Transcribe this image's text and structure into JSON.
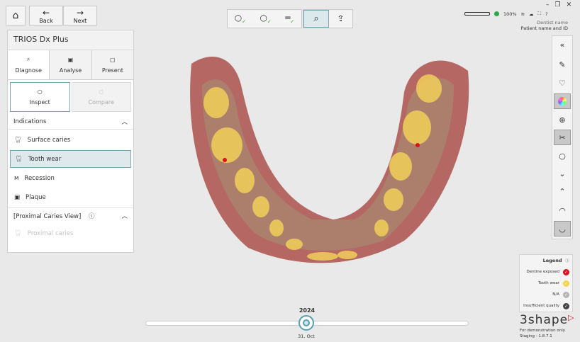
{
  "nav": {
    "back": "Back",
    "next": "Next"
  },
  "status": {
    "battery": "100%",
    "dentist": "Dentist name",
    "patient": "Patient name and ID"
  },
  "panel": {
    "title": "TRIOS Dx Plus",
    "tabs": [
      {
        "label": "Diagnose"
      },
      {
        "label": "Analyse"
      },
      {
        "label": "Present"
      }
    ],
    "modes": [
      {
        "label": "Inspect"
      },
      {
        "label": "Compare"
      }
    ],
    "indications_header": "Indications",
    "items": [
      {
        "label": "Surface caries"
      },
      {
        "label": "Tooth wear"
      },
      {
        "label": "Recession"
      },
      {
        "label": "Plaque"
      }
    ],
    "proximal_header": "[Proximal Caries View]",
    "proximal_item": "Proximal caries"
  },
  "legend": {
    "title": "Legend",
    "items": [
      {
        "label": "Dentine exposed",
        "color": "#d9151b"
      },
      {
        "label": "Tooth wear",
        "color": "#f5d547"
      },
      {
        "label": "N/A",
        "color": "#b5b5b5"
      },
      {
        "label": "Insufficient quality",
        "color": "#444444"
      }
    ]
  },
  "brand": {
    "logo": "3shape",
    "note1": "For demonstration only",
    "note2": "Staging - 1.8.7.1"
  },
  "timeline": {
    "year": "2024",
    "date": "31. Oct"
  }
}
